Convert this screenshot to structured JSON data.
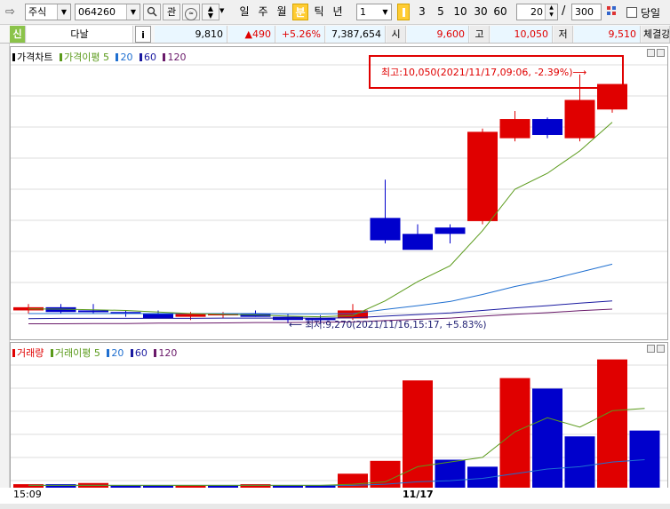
{
  "toolbar": {
    "market": "주식",
    "code": "064260",
    "btn_watch": "관",
    "periods": [
      "일",
      "주",
      "월",
      "분",
      "틱",
      "년"
    ],
    "active_period": "분",
    "interval_value": "1",
    "minute_options": [
      "3",
      "5",
      "10",
      "30",
      "60"
    ],
    "count_value": "20",
    "separator": "/",
    "total_value": "300",
    "today_label": "당일"
  },
  "quote": {
    "badge": "신",
    "name": "다날",
    "info_btn": "i",
    "price": "9,810",
    "change": "▲490",
    "change_pct": "+5.26%",
    "volume": "7,387,654",
    "open_label": "시",
    "open": "9,600",
    "high_label": "고",
    "high": "10,050",
    "low_label": "저",
    "low": "9,510",
    "trade_label": "체결강"
  },
  "price_panel": {
    "title": "가격차트",
    "ma_label": "가격이평 5",
    "ma_20": "20",
    "ma_60": "60",
    "ma_120": "120",
    "high_note": "최고:10,050(2021/11/17,09:06, -2.39%)⟶",
    "low_note": "⟵ 최저:9,270(2021/11/16,15:17, +5.83%)"
  },
  "volume_panel": {
    "title": "거래량",
    "ma_label": "거래이평 5",
    "ma_20": "20",
    "ma_60": "60",
    "ma_120": "120"
  },
  "x_axis": {
    "labels": [
      "15:09",
      "11/17"
    ]
  },
  "colors": {
    "up": "#e00000",
    "down": "#0000cc",
    "ma5": "#5a9a1a",
    "ma20": "#1f6fd0",
    "ma60": "#1a1aa0",
    "ma120": "#6a1a6a"
  },
  "chart_data": {
    "type": "candlestick",
    "timeframe": "1-minute",
    "candles": [
      {
        "o": 9310,
        "h": 9330,
        "l": 9300,
        "c": 9320
      },
      {
        "o": 9320,
        "h": 9330,
        "l": 9300,
        "c": 9305
      },
      {
        "o": 9310,
        "h": 9330,
        "l": 9300,
        "c": 9305
      },
      {
        "o": 9305,
        "h": 9310,
        "l": 9290,
        "c": 9300
      },
      {
        "o": 9300,
        "h": 9310,
        "l": 9290,
        "c": 9285
      },
      {
        "o": 9290,
        "h": 9305,
        "l": 9280,
        "c": 9300
      },
      {
        "o": 9295,
        "h": 9305,
        "l": 9285,
        "c": 9300
      },
      {
        "o": 9300,
        "h": 9310,
        "l": 9290,
        "c": 9290
      },
      {
        "o": 9290,
        "h": 9300,
        "l": 9270,
        "c": 9280
      },
      {
        "o": 9285,
        "h": 9295,
        "l": 9270,
        "c": 9280
      },
      {
        "o": 9285,
        "h": 9330,
        "l": 9280,
        "c": 9310
      },
      {
        "o": 9600,
        "h": 9720,
        "l": 9520,
        "c": 9530
      },
      {
        "o": 9550,
        "h": 9580,
        "l": 9510,
        "c": 9500
      },
      {
        "o": 9570,
        "h": 9580,
        "l": 9520,
        "c": 9550
      },
      {
        "o": 9590,
        "h": 9880,
        "l": 9580,
        "c": 9870
      },
      {
        "o": 9850,
        "h": 9935,
        "l": 9840,
        "c": 9910
      },
      {
        "o": 9910,
        "h": 9915,
        "l": 9850,
        "c": 9860
      },
      {
        "o": 9850,
        "h": 10050,
        "l": 9840,
        "c": 9970
      },
      {
        "o": 9940,
        "h": 10010,
        "l": 9930,
        "c": 10020
      }
    ],
    "y_range": [
      9250,
      10080
    ],
    "ma5": [
      9315,
      9314,
      9312,
      9310,
      9305,
      9300,
      9298,
      9296,
      9292,
      9290,
      9294,
      9340,
      9400,
      9450,
      9560,
      9690,
      9740,
      9810,
      9900
    ],
    "ma20": [
      9300,
      9300,
      9300,
      9300,
      9300,
      9300,
      9300,
      9300,
      9299,
      9299,
      9300,
      9313,
      9325,
      9338,
      9360,
      9385,
      9405,
      9430,
      9455
    ],
    "ma60": [
      9284,
      9285,
      9285,
      9285,
      9285,
      9285,
      9286,
      9286,
      9286,
      9286,
      9287,
      9292,
      9297,
      9302,
      9310,
      9318,
      9325,
      9333,
      9340
    ],
    "ma120": [
      9268,
      9268,
      9269,
      9269,
      9270,
      9270,
      9271,
      9272,
      9272,
      9273,
      9274,
      9278,
      9282,
      9286,
      9292,
      9298,
      9303,
      9309,
      9314
    ],
    "volume": [
      3,
      3,
      4,
      2,
      2,
      2,
      2,
      3,
      2,
      2,
      12,
      23,
      92,
      24,
      18,
      94,
      85,
      44,
      110,
      49
    ],
    "volume_up": [
      true,
      false,
      true,
      false,
      false,
      true,
      false,
      true,
      false,
      false,
      true,
      true,
      true,
      false,
      false,
      true,
      false,
      false,
      true,
      false
    ],
    "volume_ma5": [
      2,
      2,
      2,
      2,
      2,
      2,
      2,
      2,
      2,
      2,
      3,
      5,
      18,
      22,
      26,
      48,
      60,
      52,
      66,
      68
    ],
    "volume_ma20": [
      2,
      2,
      2,
      2,
      2,
      2,
      2,
      2,
      2,
      2,
      2,
      3,
      5,
      6,
      8,
      12,
      16,
      18,
      22,
      24
    ]
  }
}
